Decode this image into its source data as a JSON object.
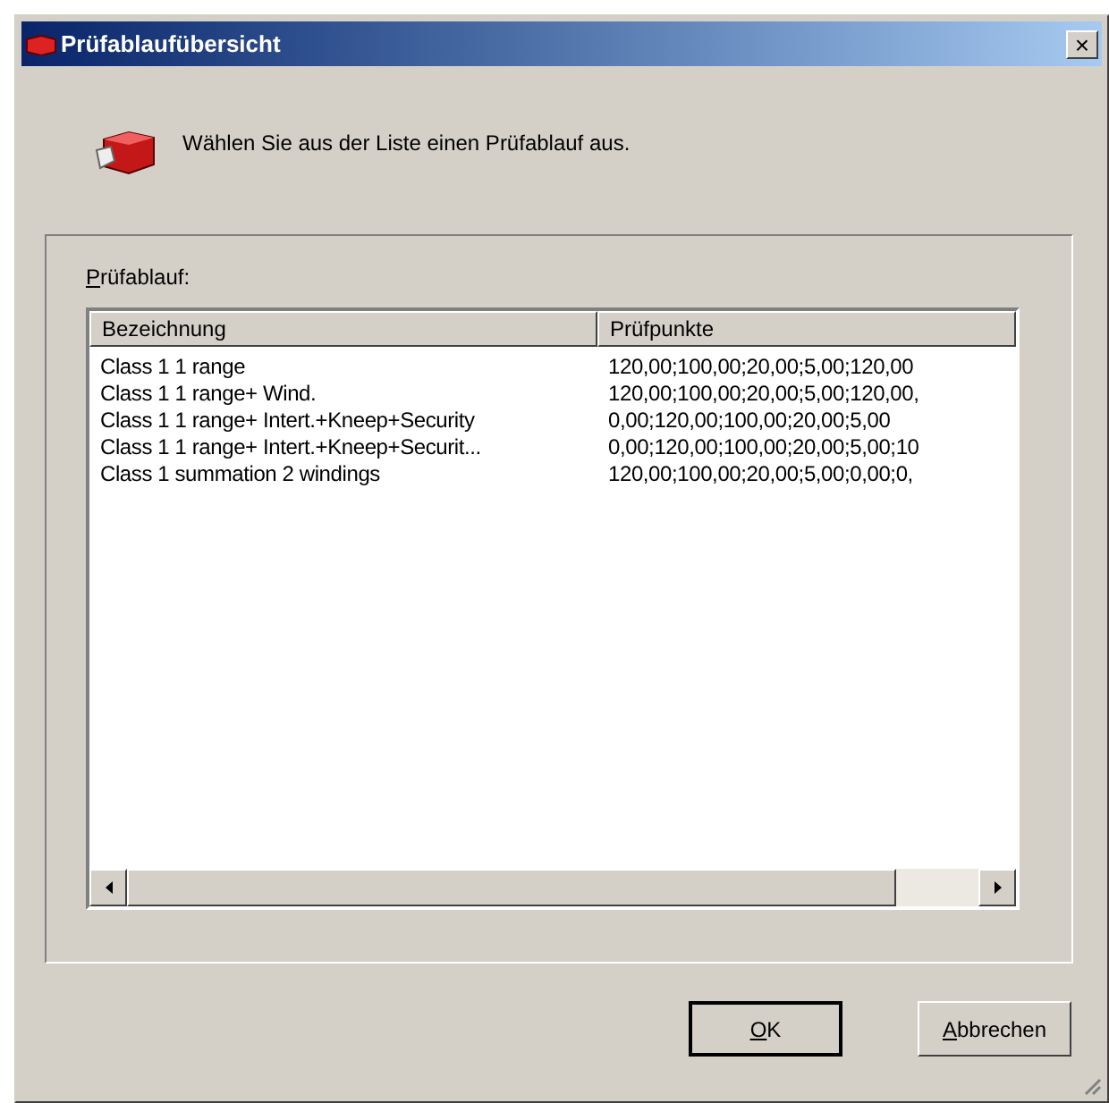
{
  "window": {
    "title": "Prüfablaufübersicht",
    "close": "×"
  },
  "instruction": "Wählen Sie aus der Liste einen Prüfablauf aus.",
  "group": {
    "label": "Prüfablauf:"
  },
  "table": {
    "columns": [
      "Bezeichnung",
      "Prüfpunkte"
    ],
    "rows": [
      {
        "name": "Class 1 1 range",
        "points": "120,00;100,00;20,00;5,00;120,00"
      },
      {
        "name": "Class 1 1 range+ Wind.",
        "points": "120,00;100,00;20,00;5,00;120,00,"
      },
      {
        "name": "Class 1 1 range+ Intert.+Kneep+Security",
        "points": "0,00;120,00;100,00;20,00;5,00"
      },
      {
        "name": "Class 1 1 range+ Intert.+Kneep+Securit...",
        "points": "0,00;120,00;100,00;20,00;5,00;10"
      },
      {
        "name": "Class 1 summation 2 windings",
        "points": "120,00;100,00;20,00;5,00;0,00;0,"
      }
    ]
  },
  "buttons": [
    {
      "label": "OK",
      "default": true
    },
    {
      "label": "Abbrechen",
      "default": false
    }
  ]
}
